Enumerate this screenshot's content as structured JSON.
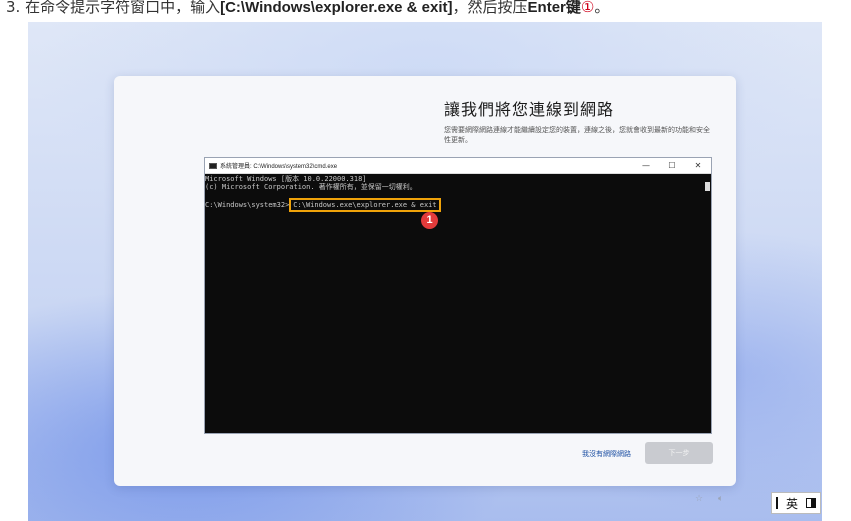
{
  "instruction": {
    "step": "3.",
    "prefix": "在命令提示字符窗口中，输入",
    "command": "[C:\\Windows\\explorer.exe & exit]",
    "middle": "，然后按压",
    "key": "Enter",
    "suffix_key": "键",
    "circled": "①",
    "end": "。"
  },
  "oobe": {
    "title": "讓我們將您連線到網路",
    "description": "您需要網際網路連線才能繼續設定您的裝置，連線之後，您就會收到最新的功能和安全性更新。",
    "skip_link": "我沒有網際網路",
    "next_button": "下一步"
  },
  "cmd": {
    "window_title": "系統管理員: C:\\Windows\\system32\\cmd.exe",
    "controls": {
      "minimize": "—",
      "maximize": "☐",
      "close": "✕"
    },
    "line1": "Microsoft Windows [版本 10.0.22000.318]",
    "line2": "(c) Microsoft Corporation. 著作權所有，並保留一切權利。",
    "prompt": "C:\\Windows\\system32>",
    "typed_command": "C:\\Windows.exe\\explorer.exe & exit"
  },
  "annotation": {
    "marker_label": "1",
    "marker_color": "#e23b3b",
    "highlight_color": "#f0a30a"
  },
  "tray": {
    "accessibility_icon": "accessibility-icon",
    "volume_icon": "volume-icon",
    "ime_mode": "英"
  }
}
